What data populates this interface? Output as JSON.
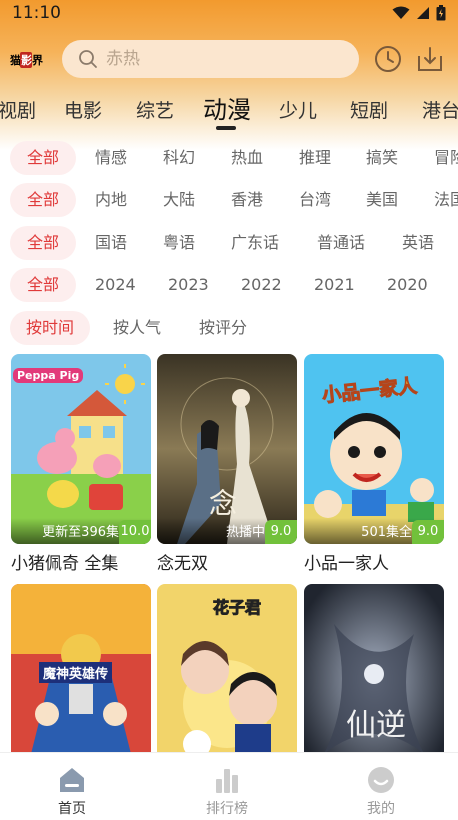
{
  "status_bar": {
    "time": "11:10"
  },
  "header": {
    "logo": {
      "left": "猫",
      "mid": "影",
      "right": "界"
    },
    "search_placeholder": "赤热"
  },
  "categories": [
    {
      "label": "视剧",
      "active": false
    },
    {
      "label": "电影",
      "active": false
    },
    {
      "label": "综艺",
      "active": false
    },
    {
      "label": "动漫",
      "active": true
    },
    {
      "label": "少儿",
      "active": false
    },
    {
      "label": "短剧",
      "active": false
    },
    {
      "label": "港台",
      "active": false
    }
  ],
  "filters": {
    "genre": [
      "全部",
      "情感",
      "科幻",
      "热血",
      "推理",
      "搞笑",
      "冒险"
    ],
    "region": [
      "全部",
      "内地",
      "大陆",
      "香港",
      "台湾",
      "美国",
      "法国"
    ],
    "language": [
      "全部",
      "国语",
      "粤语",
      "广东话",
      "普通话",
      "英语"
    ],
    "year": [
      "全部",
      "2024",
      "2023",
      "2022",
      "2021",
      "2020"
    ],
    "sort": [
      "按时间",
      "按人气",
      "按评分"
    ]
  },
  "items": [
    {
      "title": "小猪佩奇 全集",
      "episode": "更新至396集",
      "score": "10.0",
      "poster_text": "Peppa Pig"
    },
    {
      "title": "念无双",
      "episode": "热播中",
      "score": "9.0",
      "poster_text": "念"
    },
    {
      "title": "小品一家人",
      "episode": "501集全",
      "score": "9.0",
      "poster_text": "小品一家人"
    },
    {
      "title": "",
      "episode": "",
      "score": "",
      "poster_text": "魔神英雄传"
    },
    {
      "title": "",
      "episode": "",
      "score": "",
      "poster_text": "花子君"
    },
    {
      "title": "",
      "episode": "",
      "score": "",
      "poster_text": "仙逆"
    }
  ],
  "bottom_nav": [
    {
      "label": "首页",
      "icon": "home-icon",
      "active": true
    },
    {
      "label": "排行榜",
      "icon": "ranking-icon",
      "active": false
    },
    {
      "label": "我的",
      "icon": "profile-icon",
      "active": false
    }
  ],
  "colors": {
    "accent": "#e03a3a",
    "score_badge": "#72c13b",
    "header_top": "#f29a2e"
  }
}
